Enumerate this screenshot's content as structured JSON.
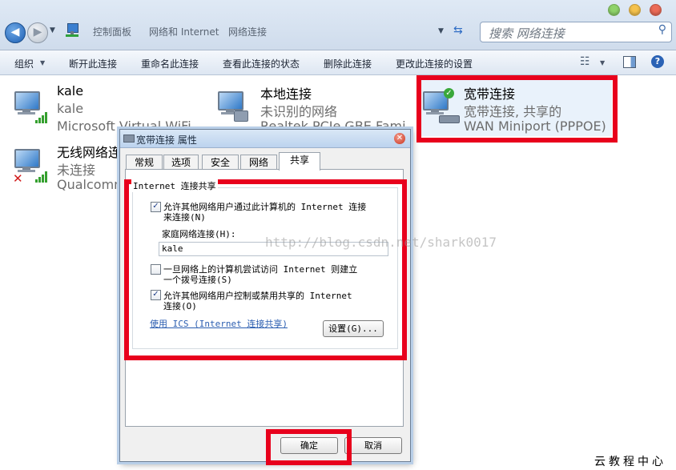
{
  "breadcrumb": [
    "控制面板",
    "网络和 Internet",
    "网络连接"
  ],
  "search": {
    "placeholder": "搜索 网络连接"
  },
  "commands": [
    "组织",
    "断开此连接",
    "重命名此连接",
    "查看此连接的状态",
    "删除此连接",
    "更改此连接的设置"
  ],
  "connections": [
    {
      "name": "kale",
      "line1": "kale",
      "line2": "Microsoft Virtual WiFi"
    },
    {
      "name": "本地连接",
      "line1": "未识别的网络",
      "line2": "Realtek PCIe GBE Fami"
    },
    {
      "name": "宽带连接",
      "line1": "宽带连接, 共享的",
      "line2": "WAN Miniport (PPPOE)"
    },
    {
      "name": "无线网络连",
      "line1": "未连接",
      "line2": "Qualcomm"
    }
  ],
  "dialog": {
    "title": "宽带连接 属性",
    "tabs": [
      "常规",
      "选项",
      "安全",
      "网络",
      "共享"
    ],
    "active_tab": "共享",
    "group_title": "Internet 连接共享",
    "option1_line1": "允许其他网络用户通过此计算机的 Internet 连接",
    "option1_line2": "来连接(N)",
    "option1_checked": true,
    "home_label": "家庭网络连接(H):",
    "home_value": "kale",
    "option2_line1": "一旦网络上的计算机尝试访问 Internet 则建立",
    "option2_line2": "一个拨号连接(S)",
    "option2_checked": false,
    "option3_line1": "允许其他网络用户控制或禁用共享的 Internet",
    "option3_line2": "连接(O)",
    "option3_checked": true,
    "ics_link": "使用 ICS (Internet 连接共享)",
    "settings_button": "设置(G)...",
    "ok_button": "确定",
    "cancel_button": "取消"
  },
  "watermark": "http://blog.csdn.net/shark0017",
  "corner_text": "云教程中心",
  "colors": {
    "highlight": "#e8001c",
    "link": "#2a5db0",
    "wifi_bars": "#35a02f"
  }
}
